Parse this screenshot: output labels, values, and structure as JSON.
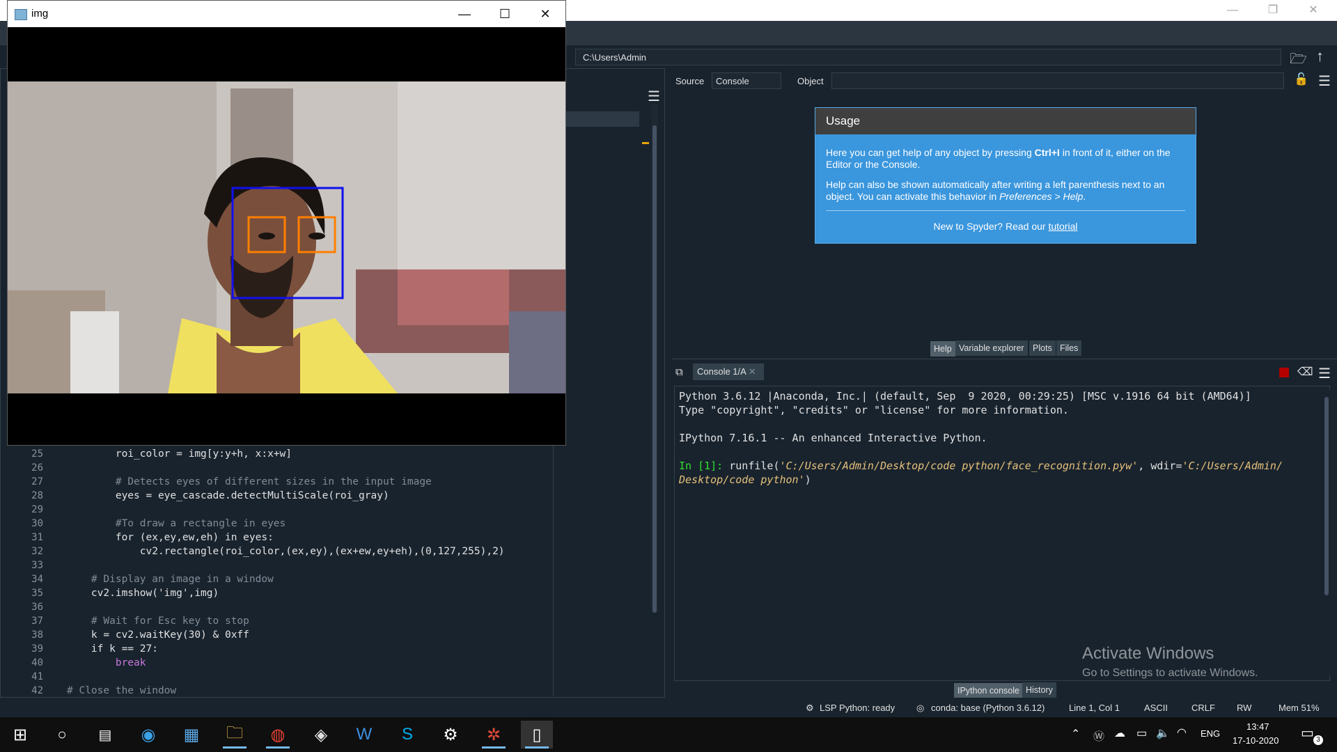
{
  "spyder": {
    "path": "C:\\Users\\Admin",
    "help": {
      "source_label": "Source",
      "source_value": "Console",
      "object_label": "Object",
      "usage_title": "Usage",
      "usage_p1_a": "Here you can get help of any object by pressing ",
      "usage_p1_key": "Ctrl+I",
      "usage_p1_b": " in front of it, either on the Editor or the Console.",
      "usage_p2_a": "Help can also be shown automatically after writing a left parenthesis next to an object. You can activate this behavior in ",
      "usage_p2_pref": "Preferences > Help",
      "usage_p2_b": ".",
      "usage_footer_a": "New to Spyder? Read our ",
      "usage_footer_link": "tutorial"
    },
    "help_tabs": [
      "Help",
      "Variable explorer",
      "Plots",
      "Files"
    ],
    "console": {
      "tab_label": "Console 1/A",
      "line1": "Python 3.6.12 |Anaconda, Inc.| (default, Sep  9 2020, 00:29:25) [MSC v.1916 64 bit (AMD64)]",
      "line2": "Type \"copyright\", \"credits\" or \"license\" for more information.",
      "line3": "IPython 7.16.1 -- An enhanced Interactive Python.",
      "prompt": "In [1]:",
      "cmd_a": " runfile(",
      "cmd_path1": "'C:/Users/Admin/Desktop/code python/face_recognition.pyw'",
      "cmd_b": ", wdir=",
      "cmd_path2a": "'C:/Users/Admin/",
      "cmd_path2b": "Desktop/code python'",
      "cmd_c": ")"
    },
    "console_tabs": [
      "IPython console",
      "History"
    ],
    "watermark_title": "Activate Windows",
    "watermark_sub": "Go to Settings to activate Windows.",
    "editor": {
      "lines": [
        {
          "n": "25",
          "code": "        roi_color = img[y:y+h, x:x+w]"
        },
        {
          "n": "26",
          "code": ""
        },
        {
          "n": "27",
          "code": "        # Detects eyes of different sizes in the input image"
        },
        {
          "n": "28",
          "code": "        eyes = eye_cascade.detectMultiScale(roi_gray)"
        },
        {
          "n": "29",
          "code": ""
        },
        {
          "n": "30",
          "code": "        #To draw a rectangle in eyes"
        },
        {
          "n": "31",
          "code": "        for (ex,ey,ew,eh) in eyes:"
        },
        {
          "n": "32",
          "code": "            cv2.rectangle(roi_color,(ex,ey),(ex+ew,ey+eh),(0,127,255),2)"
        },
        {
          "n": "33",
          "code": ""
        },
        {
          "n": "34",
          "code": "    # Display an image in a window"
        },
        {
          "n": "35",
          "code": "    cv2.imshow('img',img)"
        },
        {
          "n": "36",
          "code": ""
        },
        {
          "n": "37",
          "code": "    # Wait for Esc key to stop"
        },
        {
          "n": "38",
          "code": "    k = cv2.waitKey(30) & 0xff"
        },
        {
          "n": "39",
          "code": "    if k == 27:"
        },
        {
          "n": "40",
          "code": "        break"
        },
        {
          "n": "41",
          "code": ""
        },
        {
          "n": "42",
          "code": "# Close the window"
        }
      ]
    },
    "status": {
      "lsp": "LSP Python: ready",
      "conda": "conda: base (Python 3.6.12)",
      "position": "Line 1, Col 1",
      "encoding": "ASCII",
      "eol": "CRLF",
      "mode": "RW",
      "mem": "Mem 51%"
    }
  },
  "img_window": {
    "title": "img"
  },
  "taskbar": {
    "lang": "ENG",
    "time": "13:47",
    "date": "17-10-2020",
    "notif_count": "3"
  }
}
